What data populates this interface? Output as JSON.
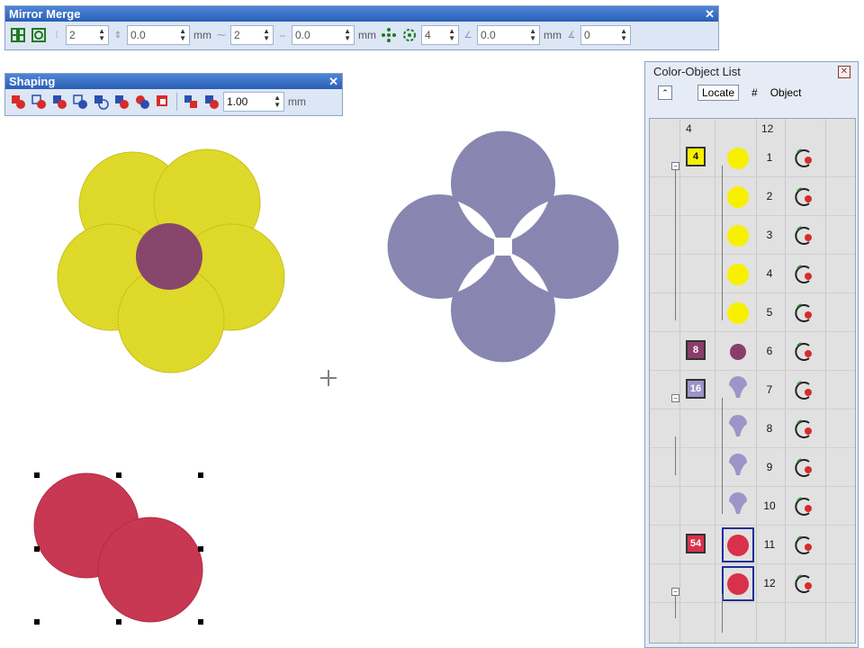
{
  "mirror_merge": {
    "title": "Mirror Merge",
    "close": "✕",
    "field1": "2",
    "field2": "0.0",
    "unit_a": "mm",
    "field3": "2",
    "field4": "0.0",
    "unit_b": "mm",
    "field5": "4",
    "field6": "0.0",
    "unit_c": "mm",
    "field7": "0"
  },
  "shaping": {
    "title": "Shaping",
    "close": "✕",
    "value": "1.00",
    "unit": "mm"
  },
  "color_list": {
    "title": "Color-Object List",
    "close": "✕",
    "locate_label": "Locate",
    "hash_label": "#",
    "object_label": "Object",
    "header_count_colors": "4",
    "header_count_objects": "12",
    "groups": [
      {
        "label": "4",
        "color": "#f7f000"
      },
      {
        "label": "8",
        "color": "#8a3d6a"
      },
      {
        "label": "16",
        "color": "#9b95c8"
      },
      {
        "label": "54",
        "color": "#d8314a"
      }
    ],
    "rows": [
      {
        "num": "1"
      },
      {
        "num": "2"
      },
      {
        "num": "3"
      },
      {
        "num": "4"
      },
      {
        "num": "5"
      },
      {
        "num": "6"
      },
      {
        "num": "7"
      },
      {
        "num": "8"
      },
      {
        "num": "9"
      },
      {
        "num": "10"
      },
      {
        "num": "11"
      },
      {
        "num": "12"
      }
    ]
  },
  "colors": {
    "yellow": "#e6e02f",
    "purple_center": "#8e4c72",
    "lavender": "#8e8cb5",
    "red": "#cf3b56",
    "title_bar": "#2a5fb6"
  }
}
